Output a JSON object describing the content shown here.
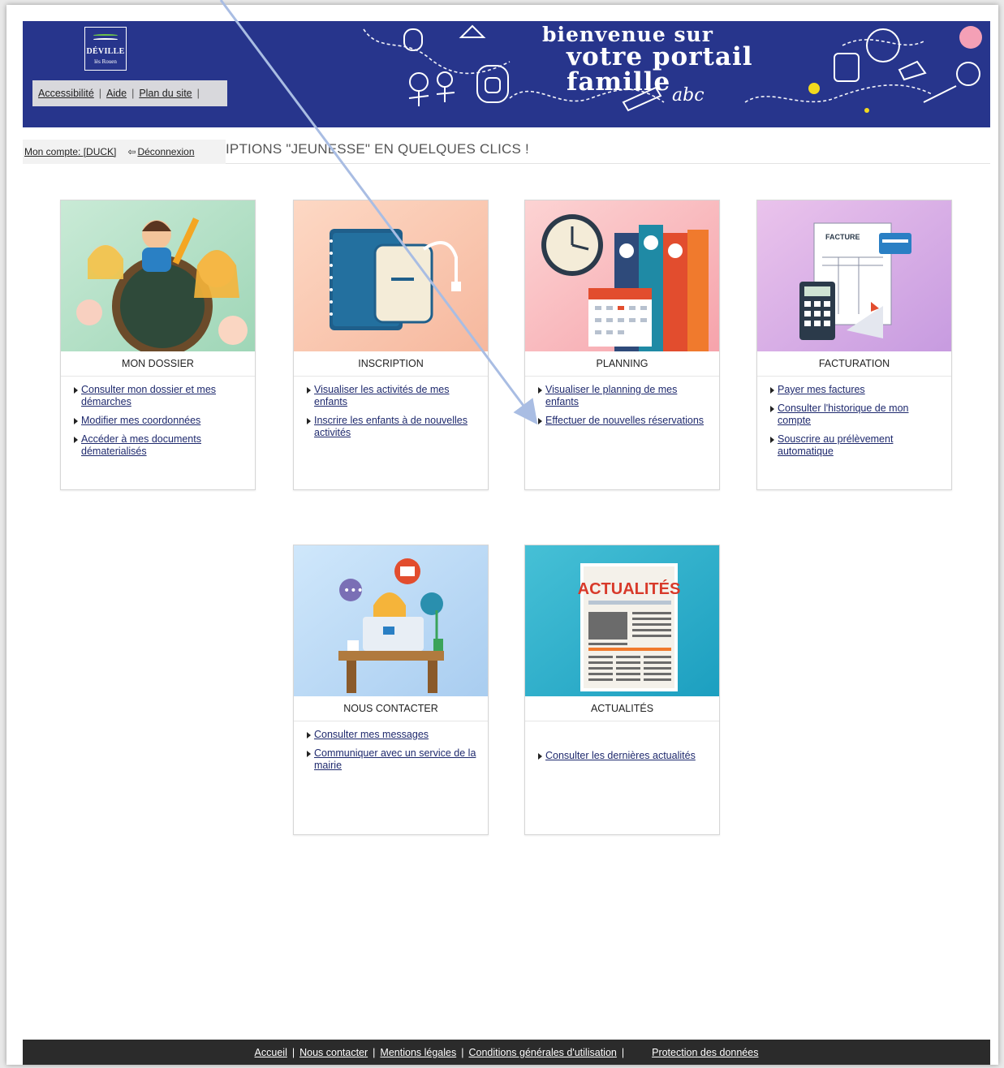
{
  "header": {
    "logo": {
      "name": "DÉVILLE",
      "sub": "lès Rouen"
    },
    "welcome_line1": "bienvenue sur",
    "welcome_line2": "votre portail famille",
    "top_links": [
      "Accessibilité",
      "Aide",
      "Plan du site"
    ],
    "top_link_separator": "|"
  },
  "account": {
    "label": "Mon compte: [DUCK]",
    "logout": "Déconnexion"
  },
  "headline": "IPTIONS \"JEUNESSE\" EN QUELQUES CLICS !",
  "tiles": [
    {
      "title": "MON DOSSIER",
      "links": [
        "Consulter mon dossier et mes démarches",
        "Modifier mes coordonnées",
        "Accéder à mes documents dématerialisés"
      ]
    },
    {
      "title": "INSCRIPTION",
      "links": [
        "Visualiser les activités de mes enfants",
        "Inscrire les enfants à de nouvelles activités"
      ]
    },
    {
      "title": "PLANNING",
      "links": [
        "Visualiser le planning de mes enfants",
        "Effectuer de nouvelles réservations"
      ]
    },
    {
      "title": "FACTURATION",
      "links": [
        "Payer mes factures",
        "Consulter l'historique de mon compte",
        "Souscrire au prélèvement automatique"
      ]
    },
    {
      "title": "NOUS CONTACTER",
      "links": [
        "Consulter mes messages",
        "Communiquer avec un service de la mairie"
      ]
    },
    {
      "title": "ACTUALITÉS",
      "links": [
        "Consulter les dernières actualités"
      ]
    }
  ],
  "tile_images": {
    "facture_label": "FACTURE",
    "actualites_label": "ACTUALITÉS"
  },
  "footer": {
    "links": [
      "Accueil",
      "Nous contacter",
      "Mentions légales",
      "Conditions générales d'utilisation",
      "Protection des données"
    ],
    "separator": "|"
  },
  "colors": {
    "banner": "#27358c",
    "link": "#1f2a6e",
    "footer": "#2b2b2b",
    "annotation_arrow": "#a9bde3"
  },
  "icons": [
    "logout-icon",
    "bullet-triangle-icon",
    "annotation-arrow"
  ]
}
